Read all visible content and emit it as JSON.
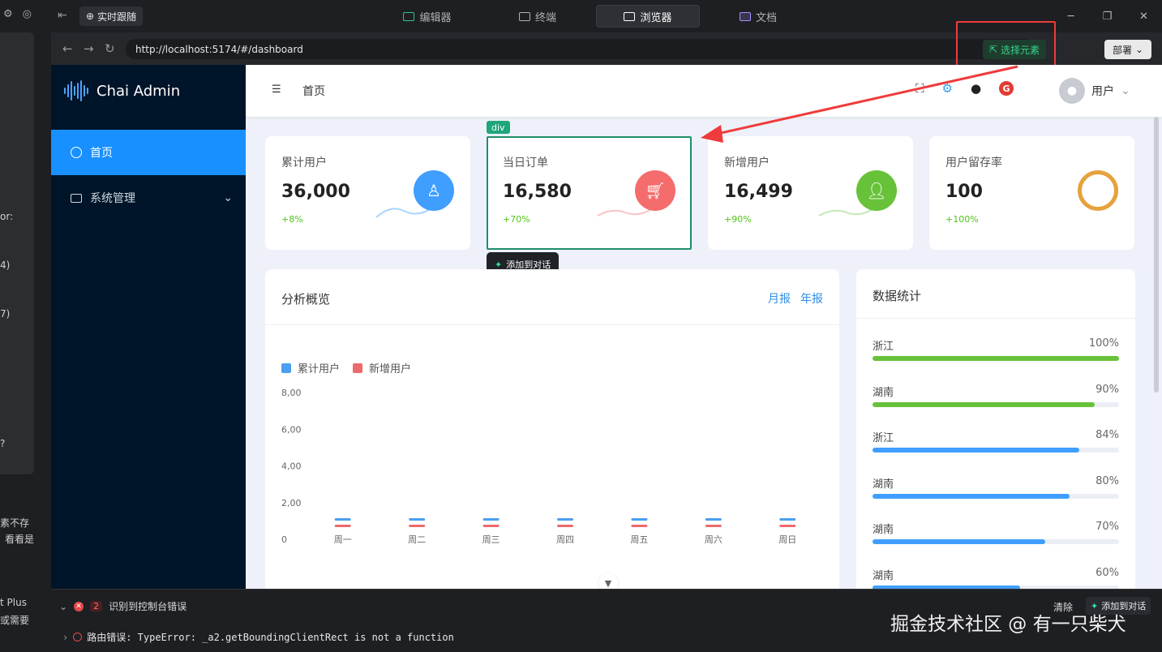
{
  "ide": {
    "realtime_label": "实时跟随",
    "tabs": [
      {
        "label": "编辑器",
        "active": false
      },
      {
        "label": "终端",
        "active": false
      },
      {
        "label": "浏览器",
        "active": true
      },
      {
        "label": "文档",
        "active": false
      }
    ],
    "left_fragments": [
      "or:",
      "4)",
      "7)",
      "?",
      "素不存",
      "看看是",
      "t Plus",
      "或需要"
    ]
  },
  "browser": {
    "url": "http://localhost:5174/#/dashboard",
    "select_element_label": "选择元素",
    "deploy_label": "部署",
    "div_tag": "div",
    "add_to_chat_label": "添加到对话"
  },
  "app": {
    "brand": "Chai Admin",
    "menu": [
      {
        "label": "首页",
        "active": true
      },
      {
        "label": "系统管理",
        "active": false
      }
    ],
    "breadcrumb": "首页",
    "user_name": "用户",
    "g_badge": "G"
  },
  "cards": [
    {
      "label": "累计用户",
      "value": "36,000",
      "change": "+8%",
      "color": "#409eff",
      "icon": "user-icon"
    },
    {
      "label": "当日订单",
      "value": "16,580",
      "change": "+70%",
      "color": "#f56c6c",
      "icon": "cart-icon"
    },
    {
      "label": "新增用户",
      "value": "16,499",
      "change": "+90%",
      "color": "#67c23a",
      "icon": "user-solid-icon"
    },
    {
      "label": "用户留存率",
      "value": "100",
      "change": "+100%",
      "color": "#e6a23c",
      "icon": "ring-icon"
    }
  ],
  "analysis": {
    "title": "分析概览",
    "link_month": "月报",
    "link_year": "年报"
  },
  "stats": {
    "title": "数据统计",
    "rows": [
      {
        "name": "浙江",
        "pct": "100%",
        "value": 100,
        "color": "#67c23a"
      },
      {
        "name": "湖南",
        "pct": "90%",
        "value": 90,
        "color": "#67c23a"
      },
      {
        "name": "浙江",
        "pct": "84%",
        "value": 84,
        "color": "#409eff"
      },
      {
        "name": "湖南",
        "pct": "80%",
        "value": 80,
        "color": "#409eff"
      },
      {
        "name": "湖南",
        "pct": "70%",
        "value": 70,
        "color": "#409eff"
      },
      {
        "name": "湖南",
        "pct": "60%",
        "value": 60,
        "color": "#409eff"
      }
    ]
  },
  "console": {
    "error_count": "2",
    "heading": "识别到控制台错误",
    "clear_label": "清除",
    "add_label": "添加到对话",
    "error_line": "路由错误: TypeError: _a2.getBoundingClientRect is not a function"
  },
  "watermark": "掘金技术社区 @ 有一只柴犬",
  "chart_data": {
    "type": "bar",
    "title": "",
    "categories": [
      "周一",
      "周二",
      "周三",
      "周四",
      "周五",
      "周六",
      "周日"
    ],
    "y_tick_labels": [
      "8,00",
      "6,00",
      "4,00",
      "2,00",
      "0"
    ],
    "ylim": [
      0,
      800
    ],
    "series": [
      {
        "name": "累计用户",
        "color": "#4a9ff0",
        "values": [
          0,
          0,
          0,
          0,
          0,
          0,
          0
        ]
      },
      {
        "name": "新增用户",
        "color": "#ee6a6a",
        "values": [
          0,
          0,
          0,
          0,
          0,
          0,
          0
        ]
      }
    ],
    "legend": "top-left",
    "grid": false
  }
}
